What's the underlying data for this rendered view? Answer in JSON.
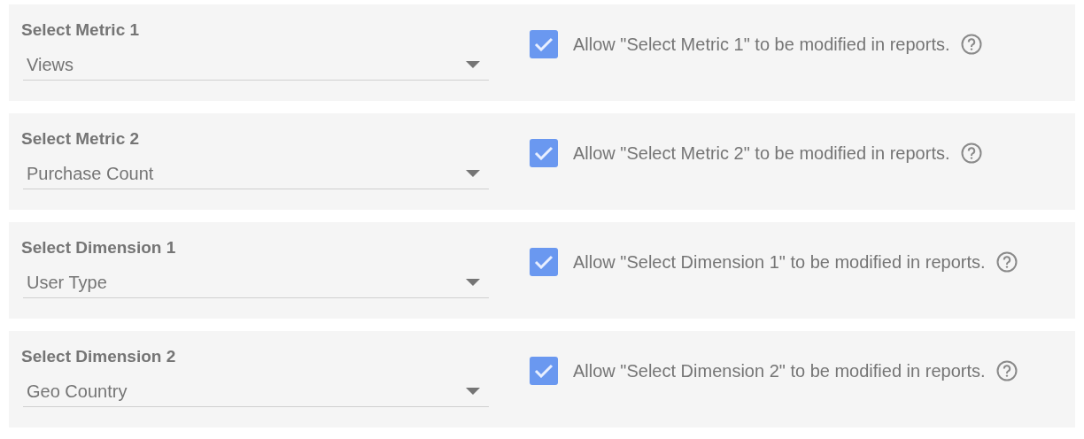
{
  "controls": [
    {
      "label": "Select Metric 1",
      "value": "Views",
      "allow_label": "Allow \"Select Metric 1\" to be modified in reports.",
      "checked": true
    },
    {
      "label": "Select Metric 2",
      "value": "Purchase Count",
      "allow_label": "Allow \"Select Metric 2\" to be modified in reports.",
      "checked": true
    },
    {
      "label": "Select Dimension 1",
      "value": "User Type",
      "allow_label": "Allow \"Select Dimension 1\" to be modified in reports.",
      "checked": true
    },
    {
      "label": "Select Dimension 2",
      "value": "Geo Country",
      "allow_label": "Allow \"Select Dimension 2\" to be modified in reports.",
      "checked": true
    }
  ]
}
